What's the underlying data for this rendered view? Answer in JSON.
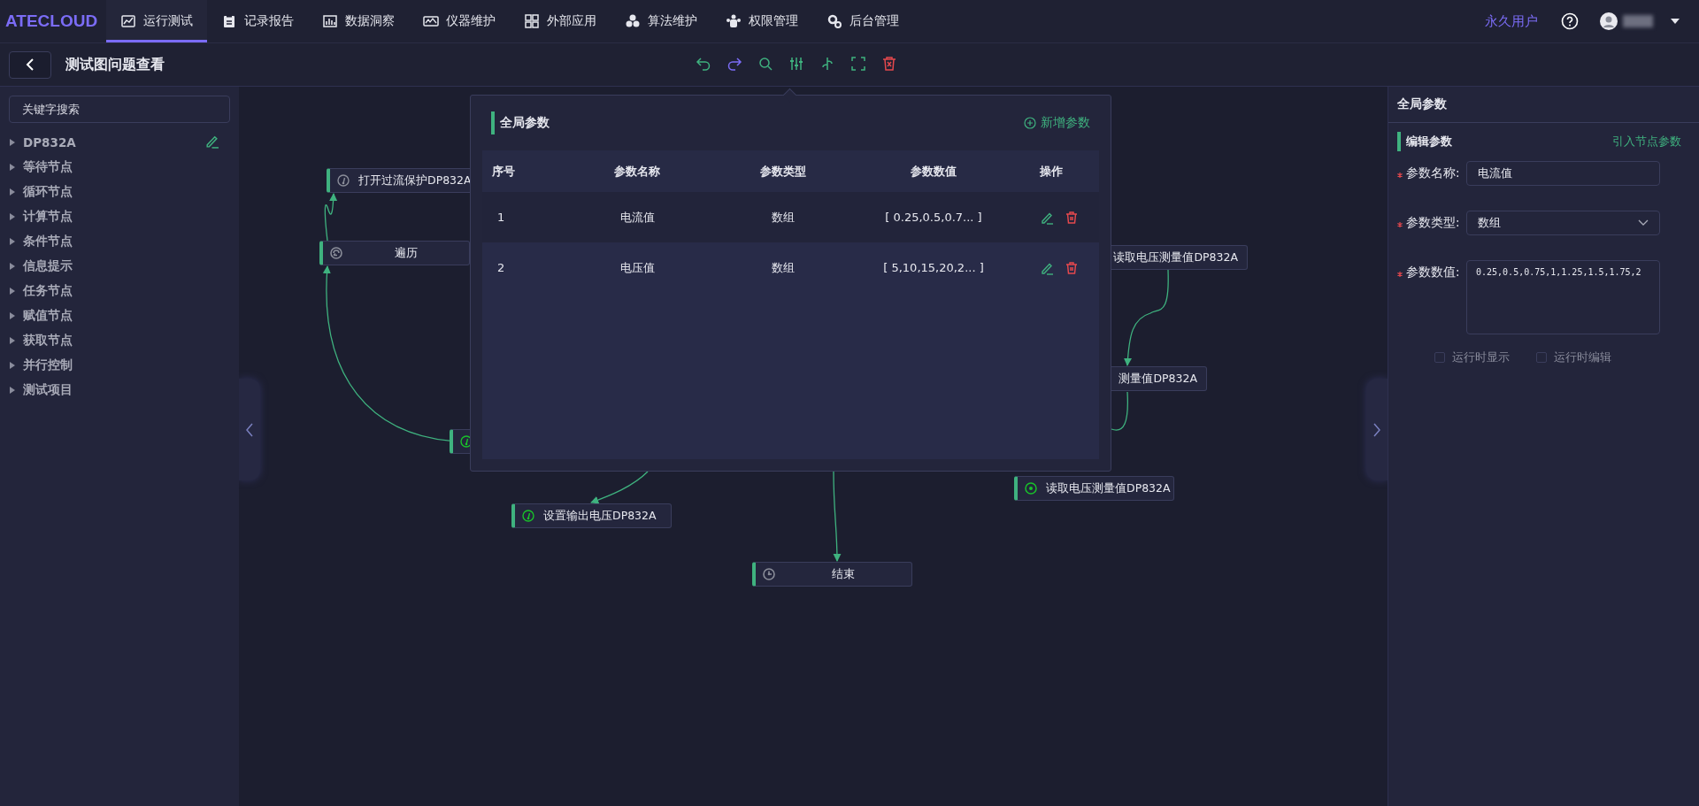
{
  "app": {
    "logo": "ATECLOUD"
  },
  "nav": [
    {
      "label": "运行测试",
      "selected": true
    },
    {
      "label": "记录报告",
      "selected": false
    },
    {
      "label": "数据洞察",
      "selected": false
    },
    {
      "label": "仪器维护",
      "selected": false
    },
    {
      "label": "外部应用",
      "selected": false
    },
    {
      "label": "算法维护",
      "selected": false
    },
    {
      "label": "权限管理",
      "selected": false
    },
    {
      "label": "后台管理",
      "selected": false
    }
  ],
  "user": {
    "role": "永久用户"
  },
  "page": {
    "title": "测试图问题查看"
  },
  "sidebar": {
    "search": {
      "placeholder": "关键字搜索"
    },
    "items": [
      {
        "label": "DP832A",
        "expanded": false
      },
      {
        "label": "等待节点",
        "expanded": false
      },
      {
        "label": "循环节点",
        "expanded": false
      },
      {
        "label": "计算节点",
        "expanded": false
      },
      {
        "label": "条件节点",
        "expanded": false
      },
      {
        "label": "信息提示",
        "expanded": false
      },
      {
        "label": "任务节点",
        "expanded": false
      },
      {
        "label": "赋值节点",
        "expanded": false
      },
      {
        "label": "获取节点",
        "expanded": false
      },
      {
        "label": "并行控制",
        "expanded": false
      },
      {
        "label": "测试项目",
        "expanded": false
      }
    ]
  },
  "canvas": {
    "nodes": [
      {
        "label": "打开过流保护DP832A",
        "kind": "instrument",
        "color": "#8a8d99"
      },
      {
        "label": "遍历",
        "kind": "loop",
        "color": "#8a8d99"
      },
      {
        "kind": "instrument",
        "color": "#19c22a"
      },
      {
        "label": "设置输出电压DP832A",
        "kind": "instrument",
        "color": "#19c22a"
      },
      {
        "label": "结束",
        "kind": "end",
        "color": "#8a8d99"
      },
      {
        "label": "读取电压测量值DP832A"
      },
      {
        "label": "测量值DP832A"
      },
      {
        "label": "读取电压测量值DP832A",
        "kind": "reading",
        "color": "#19c22a"
      }
    ]
  },
  "global_params": {
    "title": "全局参数",
    "add": "新增参数",
    "columns": [
      "序号",
      "参数名称",
      "参数类型",
      "参数数值",
      "操作"
    ],
    "rows": [
      {
        "index": "1",
        "name": "电流值",
        "type": "数组",
        "value": "[ 0.25,0.5,0.7... ]",
        "selected": true
      },
      {
        "index": "2",
        "name": "电压值",
        "type": "数组",
        "value": "[ 5,10,15,20,2... ]",
        "selected": false
      }
    ]
  },
  "right_panel": {
    "title": "全局参数",
    "section": "编辑参数",
    "link": "引入节点参数",
    "fields": [
      {
        "label": "参数名称:",
        "value": "电流值",
        "kind": "input",
        "required": true
      },
      {
        "label": "参数类型:",
        "value": "数组",
        "kind": "select",
        "required": true
      },
      {
        "label": "参数数值:",
        "value": "0.25,0.5,0.75,1,1.25,1.5,1.75,2",
        "kind": "textarea",
        "required": true
      }
    ],
    "options": [
      {
        "label": "运行时显示",
        "checked": false
      },
      {
        "label": "运行时编辑",
        "checked": false
      }
    ]
  }
}
